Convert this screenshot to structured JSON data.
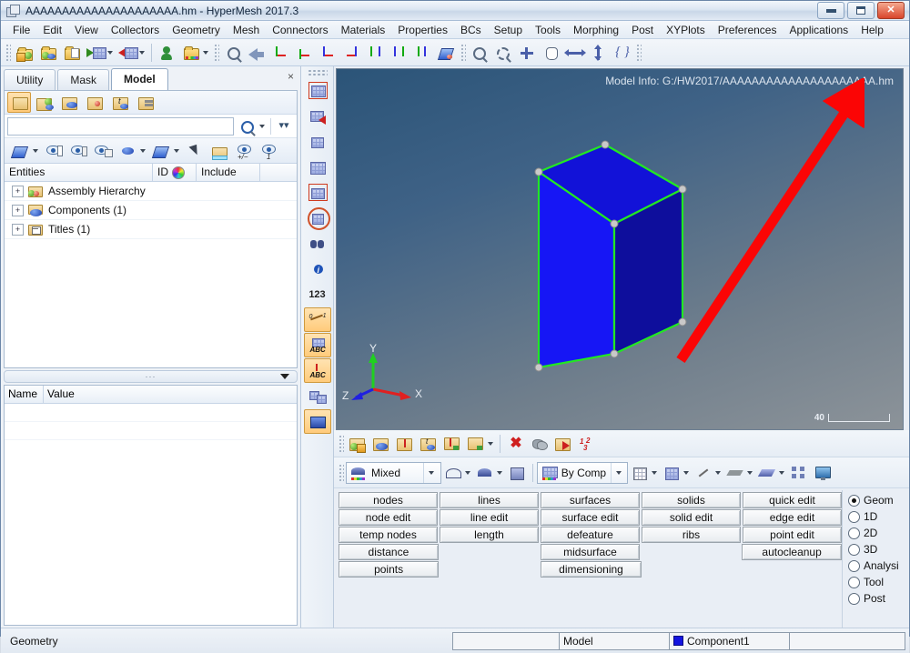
{
  "window": {
    "title": "AAAAAAAAAAAAAAAAAAAAA.hm - HyperMesh 2017.3",
    "icon": "hypermesh-cube-icon",
    "controls": {
      "minimize": "minimize",
      "maximize": "maximize",
      "close": "close"
    }
  },
  "menu": {
    "items": [
      "File",
      "Edit",
      "View",
      "Collectors",
      "Geometry",
      "Mesh",
      "Connectors",
      "Materials",
      "Properties",
      "BCs",
      "Setup",
      "Tools",
      "Morphing",
      "Post",
      "XYPlots",
      "Preferences",
      "Applications",
      "Help"
    ]
  },
  "toolbar": {
    "groups": [
      {
        "buttons": [
          {
            "name": "new-session-icon",
            "title": "New"
          },
          {
            "name": "open-model-icon",
            "title": "Open Model"
          },
          {
            "name": "save-model-icon",
            "title": "Save Model"
          },
          {
            "name": "import-icon",
            "title": "Import",
            "dropdown": true
          },
          {
            "name": "export-icon",
            "title": "Export",
            "dropdown": true
          }
        ]
      },
      {
        "buttons": [
          {
            "name": "user-profiles-icon",
            "title": "User Profiles"
          },
          {
            "name": "load-results-icon",
            "title": "Load Results",
            "dropdown": true
          }
        ]
      },
      {
        "buttons": [
          {
            "name": "fit-view-icon",
            "title": "Fit Model"
          },
          {
            "name": "previous-view-icon",
            "title": "Previous View"
          },
          {
            "name": "xy-view-icon",
            "title": "XY Top Plane View"
          },
          {
            "name": "xy-bottom-view-icon",
            "title": "XY Bottom Plane View"
          },
          {
            "name": "zx-view-icon",
            "title": "ZX Plane View"
          },
          {
            "name": "xz-view-icon",
            "title": "XZ Plane View"
          },
          {
            "name": "zy-view-icon",
            "title": "ZY Plane View"
          },
          {
            "name": "yz-view-icon",
            "title": "YZ Plane View"
          },
          {
            "name": "iso-view-icon",
            "title": "Isometric View"
          },
          {
            "name": "reflect-view-icon",
            "title": "Reflect"
          }
        ]
      },
      {
        "buttons": [
          {
            "name": "zoom-in-icon",
            "title": "Zoom In"
          },
          {
            "name": "zoom-out-icon",
            "title": "Zoom Out"
          },
          {
            "name": "circle-zoom-icon",
            "title": "Circle Zoom"
          },
          {
            "name": "pan-icon",
            "title": "Pan"
          },
          {
            "name": "rotate-horizontal-icon",
            "title": "Rotate Left/Right"
          },
          {
            "name": "rotate-vertical-icon",
            "title": "Rotate Up/Down"
          },
          {
            "name": "rotate-free-icon",
            "title": "Free Rotate"
          }
        ]
      }
    ]
  },
  "browser": {
    "tabs": [
      {
        "label": "Utility",
        "active": false
      },
      {
        "label": "Mask",
        "active": false
      },
      {
        "label": "Model",
        "active": true
      }
    ],
    "close_label": "×",
    "view_buttons": [
      {
        "name": "model-view-button",
        "selected": true
      },
      {
        "name": "assembly-view-button",
        "selected": false
      },
      {
        "name": "component-view-button",
        "selected": false
      },
      {
        "name": "load-view-button",
        "selected": false
      },
      {
        "name": "title-view-button",
        "selected": false
      },
      {
        "name": "stack-view-button",
        "selected": false
      }
    ],
    "search": {
      "value": "",
      "placeholder": ""
    },
    "search_icon": "search-icon",
    "expand_icon": "double-chevron-down-icon",
    "display_buttons": [
      {
        "name": "display-shaded-button",
        "dropdown": true
      },
      {
        "name": "isolate-button",
        "dropdown": false
      },
      {
        "name": "isolate-only-button",
        "dropdown": false
      },
      {
        "name": "isolate-group-button",
        "dropdown": false
      },
      {
        "name": "element-color-button",
        "dropdown": true
      },
      {
        "name": "geometry-color-button",
        "dropdown": true
      },
      {
        "name": "pointer-select-button",
        "dropdown": false
      },
      {
        "name": "folder-export-button",
        "dropdown": false
      },
      {
        "name": "show-hide-button",
        "dropdown": false
      },
      {
        "name": "show-one-button",
        "dropdown": false
      }
    ],
    "tree_headers": {
      "entities": "Entities",
      "id": "ID",
      "color": "color-wheel-icon",
      "include": "Include"
    },
    "tree_rows": [
      {
        "label": "Assembly Hierarchy",
        "icon": "assembly-folder-icon",
        "expander": "+"
      },
      {
        "label": "Components (1)",
        "icon": "component-folder-icon",
        "expander": "+"
      },
      {
        "label": "Titles (1)",
        "icon": "title-folder-icon",
        "expander": "+"
      }
    ],
    "splitter": {
      "dots": "···",
      "arrow": "collapse-arrow-icon"
    },
    "name_value": {
      "headers": [
        "Name",
        "Value"
      ],
      "rows": []
    }
  },
  "vtoolbar": {
    "buttons": [
      {
        "name": "mesh-display-icon",
        "selected": false,
        "style": "redbox"
      },
      {
        "name": "mesh-flow-icon",
        "selected": false,
        "style": "plain"
      },
      {
        "name": "mesh-shrink-icon",
        "selected": false,
        "style": "plain"
      },
      {
        "name": "mesh-solid-icon",
        "selected": false,
        "style": "plain"
      },
      {
        "name": "mesh-box-icon",
        "selected": false,
        "style": "redbox"
      },
      {
        "name": "mesh-circle-icon",
        "selected": false,
        "style": "ring"
      },
      {
        "name": "binoculars-icon",
        "selected": false,
        "style": "plain"
      },
      {
        "name": "info-icon",
        "selected": false,
        "style": "plain"
      },
      {
        "name": "numbers-icon",
        "selected": false,
        "style": "plain"
      },
      {
        "name": "measure-icon",
        "selected": true,
        "style": "plain"
      },
      {
        "name": "element-label-icon",
        "selected": true,
        "style": "plain"
      },
      {
        "name": "node-label-icon",
        "selected": true,
        "style": "plain"
      },
      {
        "name": "translate-icon",
        "selected": false,
        "style": "plain"
      },
      {
        "name": "surface-edit-icon",
        "selected": true,
        "style": "plain"
      }
    ]
  },
  "viewport": {
    "model_info": "Model Info: G:/HW2017/AAAAAAAAAAAAAAAAAAAAA.hm",
    "scale_value": "40",
    "axis_labels": {
      "x": "X",
      "y": "Y",
      "z": "Z"
    },
    "colors": {
      "background_top": "#2b5478",
      "background_bottom": "#8c9399",
      "face_front": "#1616f0",
      "face_top": "#1010cf",
      "face_right": "#10109a",
      "edge": "#20e820",
      "vertex": "#c8c8c8",
      "annotation_arrow": "#fb0505",
      "axis_x": "#e02020",
      "axis_y": "#20d020",
      "axis_z": "#2020e0"
    }
  },
  "bottom_toolbar": {
    "row1": [
      {
        "name": "collector-create-icon"
      },
      {
        "name": "component-collector-icon"
      },
      {
        "name": "load-collector-icon"
      },
      {
        "name": "title-collector-icon"
      },
      {
        "name": "organize-icon"
      },
      {
        "name": "assign-icon",
        "dropdown": true
      },
      {
        "name": "delete-icon"
      },
      {
        "name": "mask-icon"
      },
      {
        "name": "find-icon"
      },
      {
        "name": "renumber-icon"
      }
    ],
    "shading_combo": {
      "value": "Mixed",
      "icon": "shading-mixed-icon"
    },
    "geom_buttons": [
      {
        "name": "surface-wire-icon",
        "dropdown": true
      },
      {
        "name": "surface-shaded-icon",
        "dropdown": true
      },
      {
        "name": "solid-wire-icon",
        "dropdown": false
      }
    ],
    "bycomp_combo": {
      "value": "By Comp",
      "icon": "by-comp-icon"
    },
    "mesh_buttons": [
      {
        "name": "mesh-wire-icon",
        "dropdown": true
      },
      {
        "name": "mesh-shaded-icon",
        "dropdown": true
      },
      {
        "name": "element-1d-icon",
        "dropdown": true
      },
      {
        "name": "element-2d-icon",
        "dropdown": true
      },
      {
        "name": "element-3d-icon",
        "dropdown": true
      },
      {
        "name": "connector-icon",
        "dropdown": false
      },
      {
        "name": "screen-capture-icon",
        "dropdown": false
      }
    ]
  },
  "panel": {
    "rows": [
      [
        {
          "label": "nodes",
          "visible": true
        },
        {
          "label": "lines",
          "visible": true
        },
        {
          "label": "surfaces",
          "visible": true
        },
        {
          "label": "solids",
          "visible": true
        },
        {
          "label": "quick edit",
          "visible": true
        }
      ],
      [
        {
          "label": "node edit",
          "visible": true
        },
        {
          "label": "line edit",
          "visible": true
        },
        {
          "label": "surface edit",
          "visible": true
        },
        {
          "label": "solid edit",
          "visible": true
        },
        {
          "label": "edge edit",
          "visible": true
        }
      ],
      [
        {
          "label": "temp nodes",
          "visible": true
        },
        {
          "label": "length",
          "visible": true
        },
        {
          "label": "defeature",
          "visible": true
        },
        {
          "label": "ribs",
          "visible": true
        },
        {
          "label": "point edit",
          "visible": true
        }
      ],
      [
        {
          "label": "distance",
          "visible": true
        },
        {
          "label": "",
          "visible": false
        },
        {
          "label": "midsurface",
          "visible": true
        },
        {
          "label": "",
          "visible": false
        },
        {
          "label": "autocleanup",
          "visible": true
        }
      ],
      [
        {
          "label": "points",
          "visible": true
        },
        {
          "label": "",
          "visible": false
        },
        {
          "label": "dimensioning",
          "visible": true
        },
        {
          "label": "",
          "visible": false
        },
        {
          "label": "",
          "visible": false
        }
      ]
    ],
    "modes": [
      {
        "label": "Geom",
        "selected": true
      },
      {
        "label": "1D",
        "selected": false
      },
      {
        "label": "2D",
        "selected": false
      },
      {
        "label": "3D",
        "selected": false
      },
      {
        "label": "Analysi",
        "selected": false
      },
      {
        "label": "Tool",
        "selected": false
      },
      {
        "label": "Post",
        "selected": false
      }
    ]
  },
  "statusbar": {
    "message": "Geometry",
    "field1": "",
    "field2": "Model",
    "field3": "Component1",
    "field3_color": "#1414e0",
    "field4": ""
  }
}
